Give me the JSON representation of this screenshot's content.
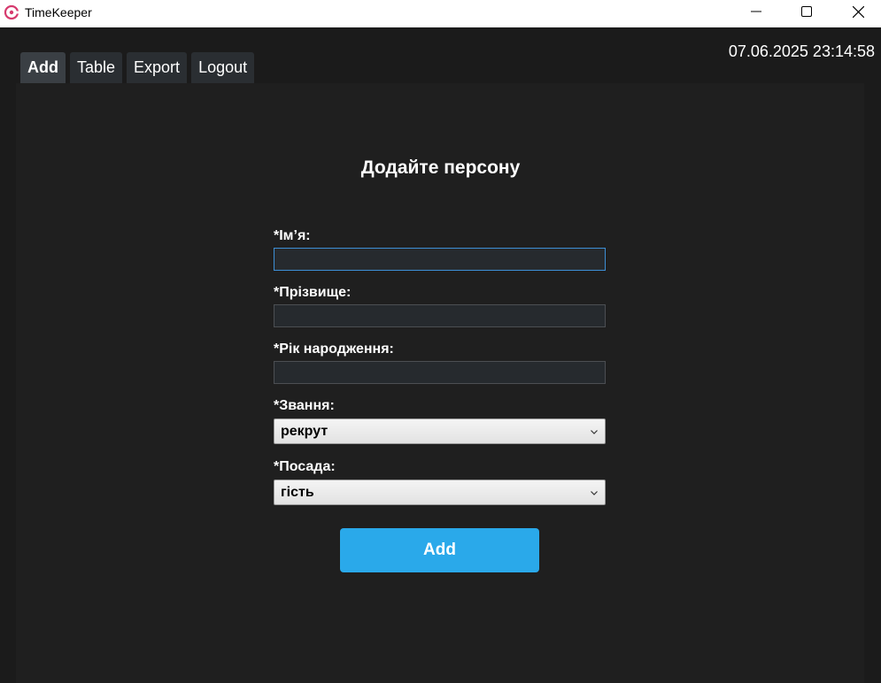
{
  "window": {
    "title": "TimeKeeper"
  },
  "header": {
    "datetime": "07.06.2025 23:14:58"
  },
  "tabs": [
    {
      "label": "Add",
      "active": true
    },
    {
      "label": "Table",
      "active": false
    },
    {
      "label": "Export",
      "active": false
    },
    {
      "label": "Logout",
      "active": false
    }
  ],
  "form": {
    "title": "Додайте персону",
    "first_name": {
      "label": "*Ім’я:",
      "value": ""
    },
    "last_name": {
      "label": "*Прізвище:",
      "value": ""
    },
    "birth_year": {
      "label": "*Рік народження:",
      "value": ""
    },
    "rank": {
      "label": "*Звання:",
      "selected": "рекрут"
    },
    "position": {
      "label": "*Посада:",
      "selected": "гість"
    },
    "submit_label": "Add"
  },
  "colors": {
    "accent": "#2aa9ea",
    "background": "#1b1b1b",
    "input_bg": "#262a2e",
    "focus_border": "#3d8fd6",
    "app_icon": "#d63a6e"
  },
  "icons": {
    "app": "timekeeper-logo",
    "minimize": "minimize-icon",
    "maximize": "maximize-icon",
    "close": "close-icon",
    "dropdown": "chevron-down-icon"
  }
}
